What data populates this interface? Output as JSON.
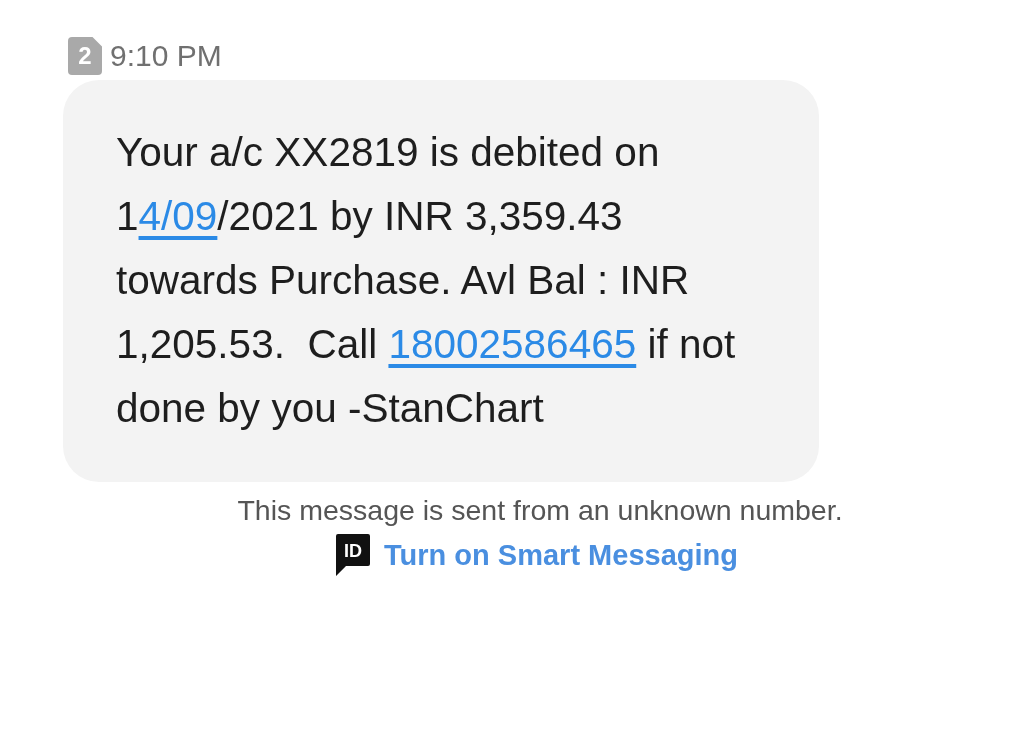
{
  "header": {
    "sim_slot": "2",
    "time": "9:10 PM"
  },
  "message": {
    "parts": [
      {
        "kind": "text",
        "text": "Your a/c XX2819 is debited on 1"
      },
      {
        "kind": "link",
        "text": "4/09"
      },
      {
        "kind": "text",
        "text": "/2021 by INR 3,359.43 towards Purchase. Avl Bal : INR 1,205.53.  Call "
      },
      {
        "kind": "link",
        "text": "18002586465"
      },
      {
        "kind": "text",
        "text": " if not done by you -StanChart"
      }
    ]
  },
  "notice": {
    "text": "This message is sent from an unknown number.",
    "badge": "ID",
    "action": "Turn on Smart Messaging"
  }
}
